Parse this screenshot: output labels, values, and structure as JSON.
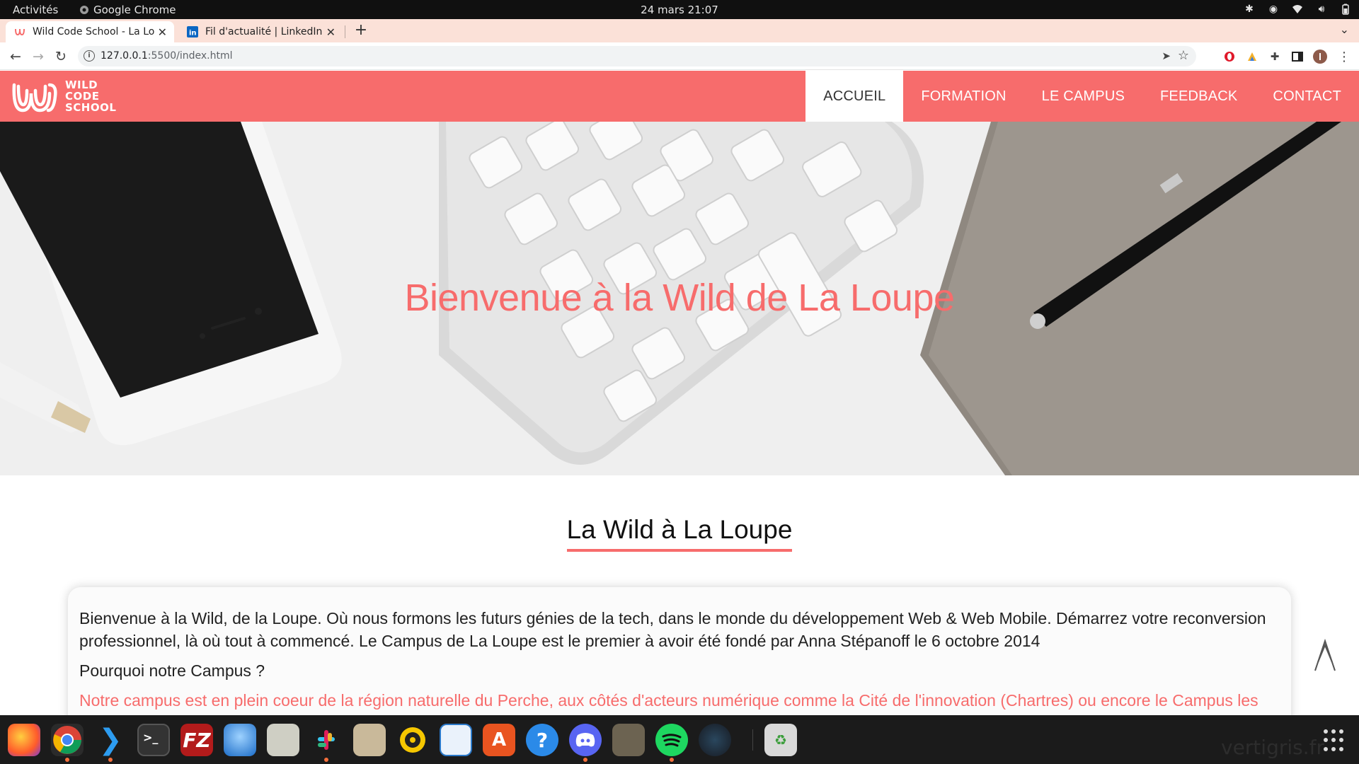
{
  "system": {
    "activities": "Activités",
    "app_name": "Google Chrome",
    "clock": "24 mars  21:07"
  },
  "browser": {
    "tabs": [
      {
        "title": "Wild Code School - La Lou",
        "active": true
      },
      {
        "title": "Fil d'actualité | LinkedIn",
        "active": false
      }
    ],
    "url_host": "127.0.0.1",
    "url_path": ":5500/index.html"
  },
  "site": {
    "logo_lines": [
      "WILD",
      "CODE",
      "SCHOOL"
    ],
    "nav": [
      "ACCUEIL",
      "FORMATION",
      "LE CAMPUS",
      "FEEDBACK",
      "CONTACT"
    ],
    "hero_title": "Bienvenue à la Wild de La Loupe",
    "section_title": "La Wild à La Loupe",
    "paragraph1": "Bienvenue à la Wild, de la Loupe. Où nous formons les futurs génies de la tech, dans le monde du développement Web & Web Mobile. Démarrez votre reconversion professionnel, là où tout à commencé. Le Campus de La Loupe est le premier à avoir été fondé par Anna Stépanoff le 6 octobre 2014",
    "question": "Pourquoi notre Campus ?",
    "highlight": "Notre campus est en plein coeur de la région naturelle du Perche, aux côtés d'acteurs numérique comme la Cité de l'innovation (Chartres) ou encore le Campus les",
    "accent_color": "#f76c6c"
  },
  "dock": {
    "apps": [
      {
        "name": "firefox-icon",
        "running": false
      },
      {
        "name": "chrome-icon",
        "running": true
      },
      {
        "name": "vscode-icon",
        "running": true
      },
      {
        "name": "terminal-icon",
        "running": false
      },
      {
        "name": "filezilla-icon",
        "running": false
      },
      {
        "name": "thunderbird-icon",
        "running": false
      },
      {
        "name": "maps-icon",
        "running": false
      },
      {
        "name": "slack-icon",
        "running": true
      },
      {
        "name": "files-icon",
        "running": false
      },
      {
        "name": "rhythmbox-icon",
        "running": false
      },
      {
        "name": "writer-icon",
        "running": false
      },
      {
        "name": "software-icon",
        "running": false
      },
      {
        "name": "help-icon",
        "running": false
      },
      {
        "name": "discord-icon",
        "running": true
      },
      {
        "name": "gimp-icon",
        "running": false
      },
      {
        "name": "spotify-icon",
        "running": true
      },
      {
        "name": "steam-icon",
        "running": false
      },
      {
        "name": "trash-icon",
        "running": false
      }
    ],
    "watermark": "vertigris.fr"
  }
}
